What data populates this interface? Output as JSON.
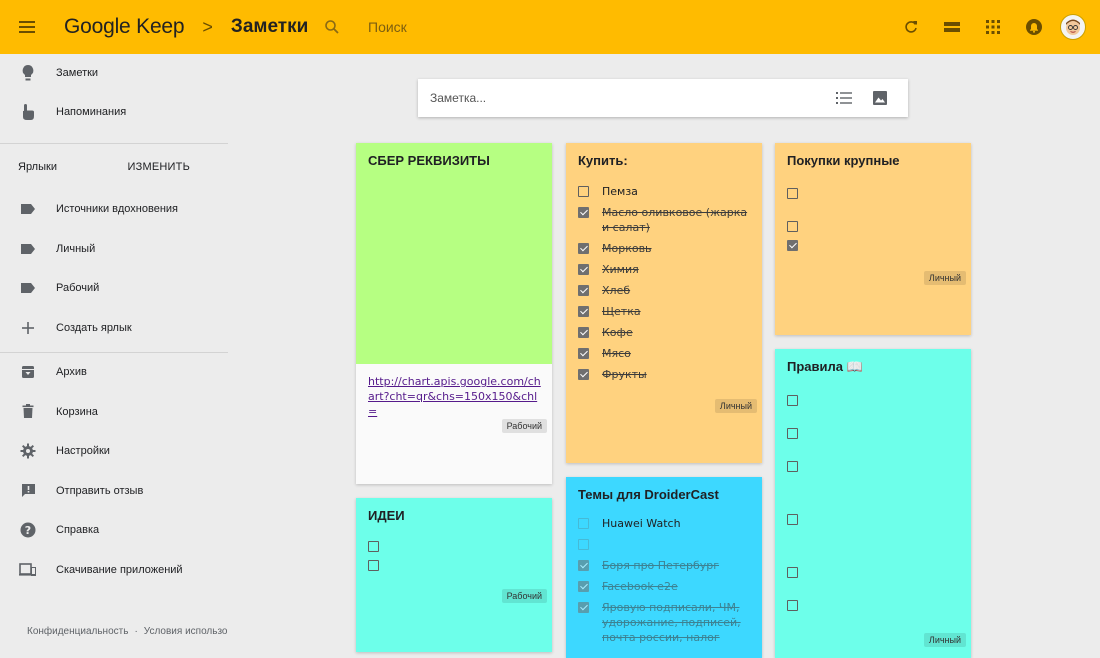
{
  "header": {
    "brand": "Google Keep",
    "crumb_sep": ">",
    "page_title": "Заметки",
    "search_placeholder": "Поиск",
    "accent": "#ffbb00"
  },
  "sidebar": {
    "top_items": [
      {
        "label": "Заметки",
        "icon": "lightbulb-icon"
      },
      {
        "label": "Напоминания",
        "icon": "pointer-hand-icon"
      }
    ],
    "labels_heading": "Ярлыки",
    "edit_label": "ИЗМЕНИТЬ",
    "label_items": [
      {
        "label": "Источники вдохновения",
        "icon": "label-icon"
      },
      {
        "label": "Личный",
        "icon": "label-icon"
      },
      {
        "label": "Рабочий",
        "icon": "label-icon"
      },
      {
        "label": "Создать ярлык",
        "icon": "plus-icon"
      }
    ],
    "bottom_items": [
      {
        "label": "Архив",
        "icon": "archive-icon"
      },
      {
        "label": "Корзина",
        "icon": "trash-icon"
      },
      {
        "label": "Настройки",
        "icon": "gear-icon"
      },
      {
        "label": "Отправить отзыв",
        "icon": "feedback-icon"
      },
      {
        "label": "Справка",
        "icon": "help-icon"
      },
      {
        "label": "Скачивание приложений",
        "icon": "devices-icon"
      }
    ],
    "footer": [
      "Конфиденциальность",
      "·",
      "Условия использования"
    ]
  },
  "compose": {
    "placeholder": "Заметка..."
  },
  "notes": {
    "sber": {
      "title": "СБЕР РЕКВИЗИТЫ",
      "color": "#b6ff82",
      "link": "http://chart.apis.google.com/chart?cht=qr&chs=150x150&chl=",
      "tag": "Рабочий"
    },
    "ideas": {
      "title": "ИДЕИ",
      "color": "#6dffea",
      "tag": "Рабочий"
    },
    "buy": {
      "title": "Купить:",
      "color": "#ffd27f",
      "items": [
        {
          "text": "Пемза",
          "done": false
        },
        {
          "text": "Масло оливковое (жарка и салат)",
          "done": true
        },
        {
          "text": "Морковь",
          "done": true
        },
        {
          "text": "Химия",
          "done": true
        },
        {
          "text": "Хлеб",
          "done": true
        },
        {
          "text": "Щетка",
          "done": true
        },
        {
          "text": "Кофе",
          "done": true
        },
        {
          "text": "Мясо",
          "done": true
        },
        {
          "text": "Фрукты",
          "done": true
        }
      ],
      "tag": "Личный"
    },
    "droider": {
      "title": "Темы для DroiderCast",
      "color": "#3dd8ff",
      "items": [
        {
          "text": "Huawei Watch",
          "done": false
        },
        {
          "text": "",
          "done": false
        },
        {
          "text": "Боря про Петербург",
          "done": true
        },
        {
          "text": "Facebook e2e",
          "done": true
        },
        {
          "text": "Яровую подписали, ЧМ, удорожание, подписей, почта россии, налог",
          "done": true
        }
      ]
    },
    "bigbuy": {
      "title": "Покупки крупные",
      "color": "#ffd27f",
      "tag": "Личный"
    },
    "rules": {
      "title": "Правила 📖",
      "color": "#6dffea",
      "tag": "Личный"
    }
  }
}
